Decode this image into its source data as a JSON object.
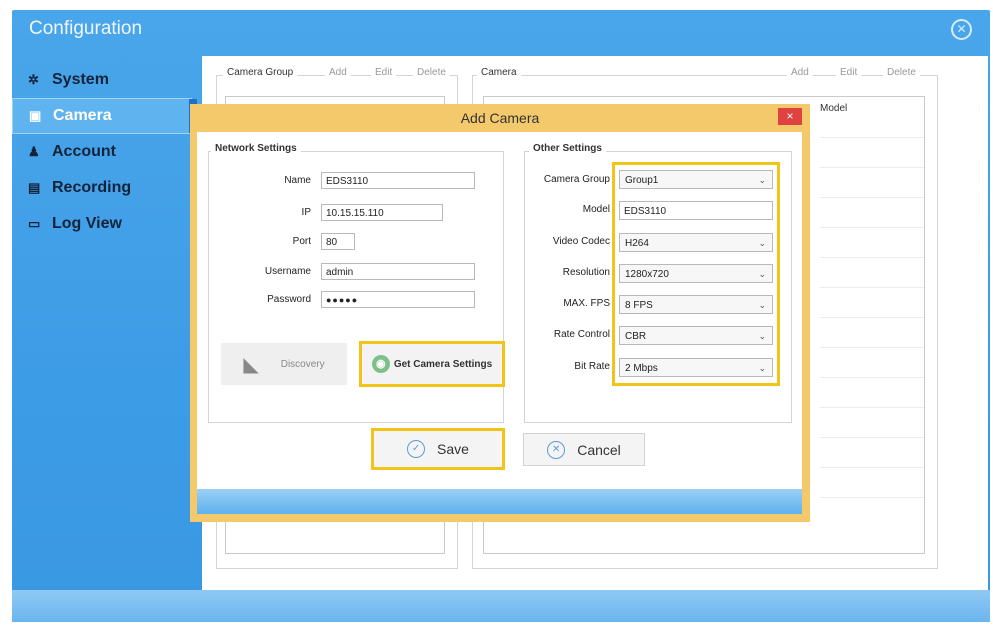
{
  "window": {
    "title": "Configuration"
  },
  "nav": {
    "items": [
      {
        "label": "System",
        "icon": "gear-icon",
        "glyph": "✲"
      },
      {
        "label": "Camera",
        "icon": "camera-icon",
        "glyph": "▣",
        "active": true
      },
      {
        "label": "Account",
        "icon": "user-icon",
        "glyph": "♟"
      },
      {
        "label": "Recording",
        "icon": "recording-icon",
        "glyph": "▤"
      },
      {
        "label": "Log View",
        "icon": "monitor-icon",
        "glyph": "▭"
      }
    ]
  },
  "camera_group": {
    "legend": "Camera Group",
    "add": "Add",
    "edit": "Edit",
    "delete": "Delete"
  },
  "camera": {
    "legend": "Camera",
    "add": "Add",
    "edit": "Edit",
    "delete": "Delete",
    "column_model": "Model"
  },
  "dialog": {
    "title": "Add Camera",
    "close": "×",
    "network": {
      "legend": "Network Settings",
      "name_label": "Name",
      "name_value": "EDS3110",
      "ip_label": "IP",
      "ip_value": "10.15.15.110",
      "port_label": "Port",
      "port_value": "80",
      "username_label": "Username",
      "username_value": "admin",
      "password_label": "Password",
      "password_value": "●●●●●"
    },
    "discovery_label": "Discovery",
    "get_settings_label": "Get Camera Settings",
    "other": {
      "legend": "Other Settings",
      "group_label": "Camera Group",
      "group_value": "Group1",
      "model_label": "Model",
      "model_value": "EDS3110",
      "codec_label": "Video Codec",
      "codec_value": "H264",
      "resolution_label": "Resolution",
      "resolution_value": "1280x720",
      "fps_label": "MAX. FPS",
      "fps_value": "8 FPS",
      "rate_label": "Rate Control",
      "rate_value": "CBR",
      "bitrate_label": "Bit Rate",
      "bitrate_value": "2 Mbps"
    },
    "save_label": "Save",
    "cancel_label": "Cancel"
  },
  "colors": {
    "highlight": "#f0c419",
    "accent": "#3d9ce6",
    "close": "#e04242"
  }
}
